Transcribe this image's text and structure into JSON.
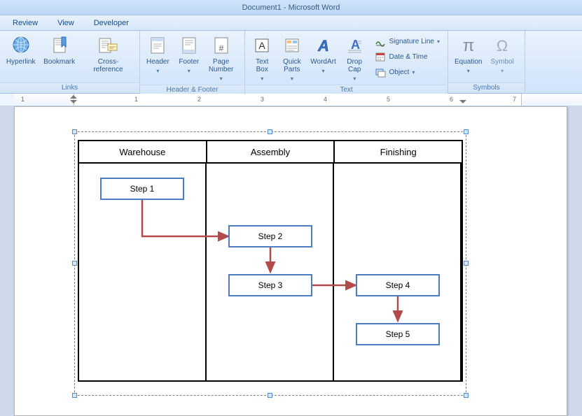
{
  "title": "Document1 - Microsoft Word",
  "tabs": {
    "review": "Review",
    "view": "View",
    "developer": "Developer"
  },
  "ribbon": {
    "links": {
      "label": "Links",
      "hyperlink": "Hyperlink",
      "bookmark": "Bookmark",
      "crossref": "Cross-reference"
    },
    "hf": {
      "label": "Header & Footer",
      "header": "Header",
      "footer": "Footer",
      "page_number": "Page\nNumber"
    },
    "text": {
      "label": "Text",
      "textbox": "Text\nBox",
      "quickparts": "Quick\nParts",
      "wordart": "WordArt",
      "dropcap": "Drop\nCap",
      "signature": "Signature Line",
      "datetime": "Date & Time",
      "object": "Object"
    },
    "symbols": {
      "label": "Symbols",
      "equation": "Equation",
      "symbol": "Symbol"
    }
  },
  "ruler": {
    "nums": [
      "1",
      "1",
      "2",
      "3",
      "4",
      "5",
      "6",
      "7"
    ]
  },
  "diagram": {
    "lanes": [
      "Warehouse",
      "Assembly",
      "Finishing"
    ],
    "steps": {
      "s1": "Step 1",
      "s2": "Step 2",
      "s3": "Step 3",
      "s4": "Step 4",
      "s5": "Step 5"
    }
  }
}
